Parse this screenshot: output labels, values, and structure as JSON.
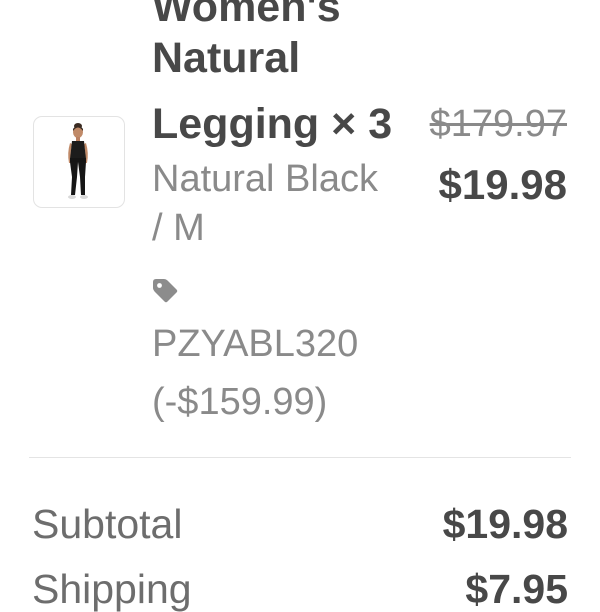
{
  "line_item": {
    "image_icon": "product-photo-woman-in-black-leggings",
    "title_lines": [
      "Women's",
      "Natural",
      "Legging × 3"
    ],
    "variant_lines": [
      "Natural Black",
      "/ M"
    ],
    "discount_icon": "tag-icon",
    "discount_code": "PZYABL320",
    "discount_amount": "(-$159.99)",
    "original_price": "$179.97",
    "final_price": "$19.98"
  },
  "summary": {
    "subtotal_label": "Subtotal",
    "subtotal_value": "$19.98",
    "shipping_label": "Shipping",
    "shipping_value": "$7.95"
  },
  "colors": {
    "text_dark": "#484848",
    "text_muted": "#8a8a8a",
    "divider": "#e4e4e4"
  }
}
